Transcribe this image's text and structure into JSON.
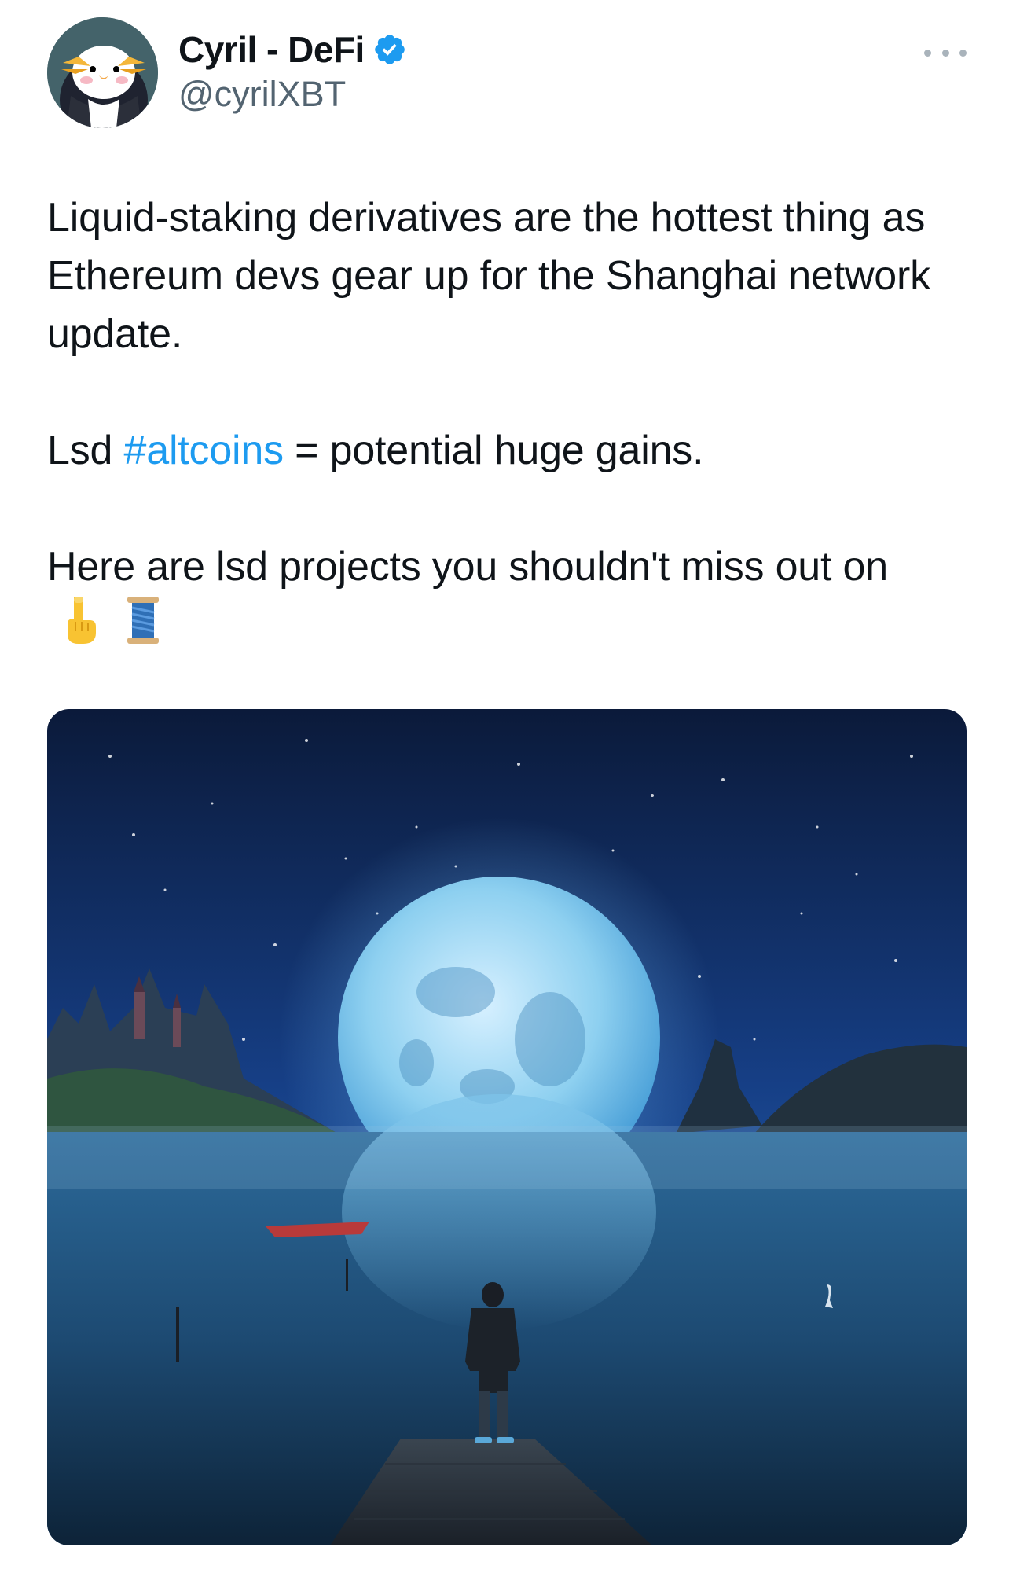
{
  "author": {
    "display_name": "Cyril - DeFi",
    "handle": "@cyrilXBT",
    "verified": true,
    "avatar_icon": "penguin-avatar"
  },
  "tweet": {
    "line1": "Liquid-staking derivatives are the hottest thing as Ethereum devs gear up for the Shanghai network update.",
    "line2_prefix": "Lsd ",
    "hashtag": "#altcoins",
    "line2_suffix": " = potential huge gains.",
    "line3": "Here are lsd projects you shouldn't miss out on",
    "emojis": [
      "👇",
      "🧵"
    ]
  },
  "colors": {
    "link": "#1d9bf0",
    "verified_badge": "#1d9bf0",
    "handle_text": "#536471"
  },
  "media": {
    "icon": "moonlit-lake-image"
  },
  "more_icon": "ellipsis-icon"
}
